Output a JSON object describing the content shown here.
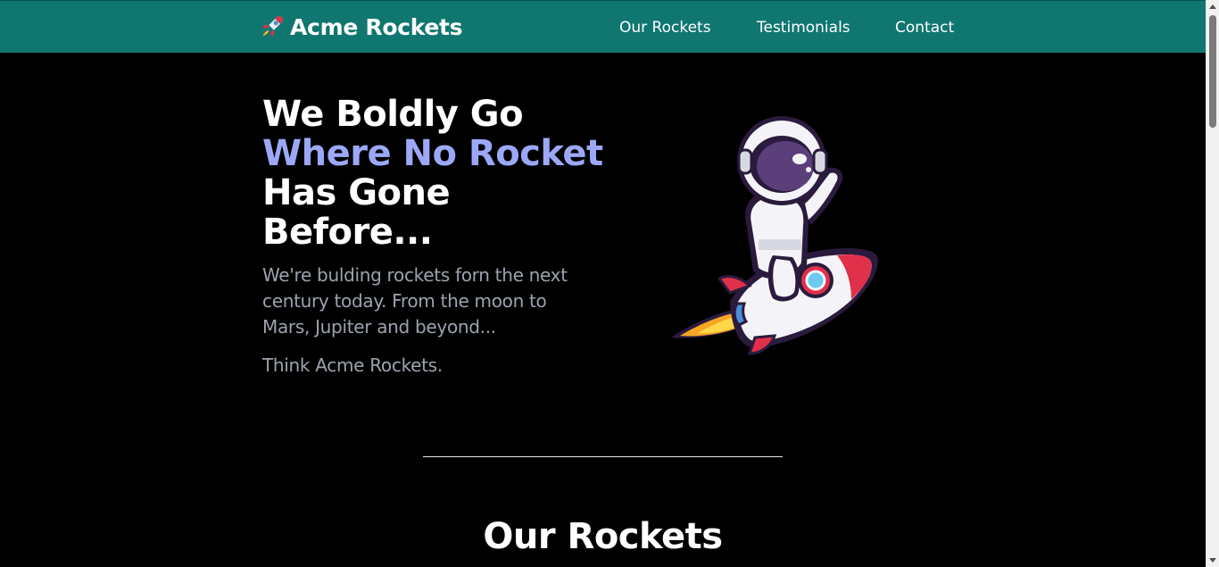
{
  "colors": {
    "header_bg": "#107670",
    "page_bg": "#000000",
    "accent_text": "#9ca8f7",
    "muted_text": "#9ca3af",
    "heading_text": "#ffffff"
  },
  "header": {
    "brand_icon": "rocket-icon",
    "brand_name": "Acme Rockets",
    "nav": [
      {
        "label": "Our Rockets"
      },
      {
        "label": "Testimonials"
      },
      {
        "label": "Contact"
      }
    ]
  },
  "hero": {
    "title_line1": "We Boldly Go",
    "title_line2": "Where No Rocket",
    "title_line3": "Has Gone",
    "title_line4": "Before...",
    "paragraph": "We're bulding rockets forn the next century today. From the moon to Mars, Jupiter and beyond...",
    "tagline": "Think Acme Rockets.",
    "image_icon": "astronaut-riding-rocket-illustration"
  },
  "sections": {
    "rockets_title": "Our Rockets"
  }
}
